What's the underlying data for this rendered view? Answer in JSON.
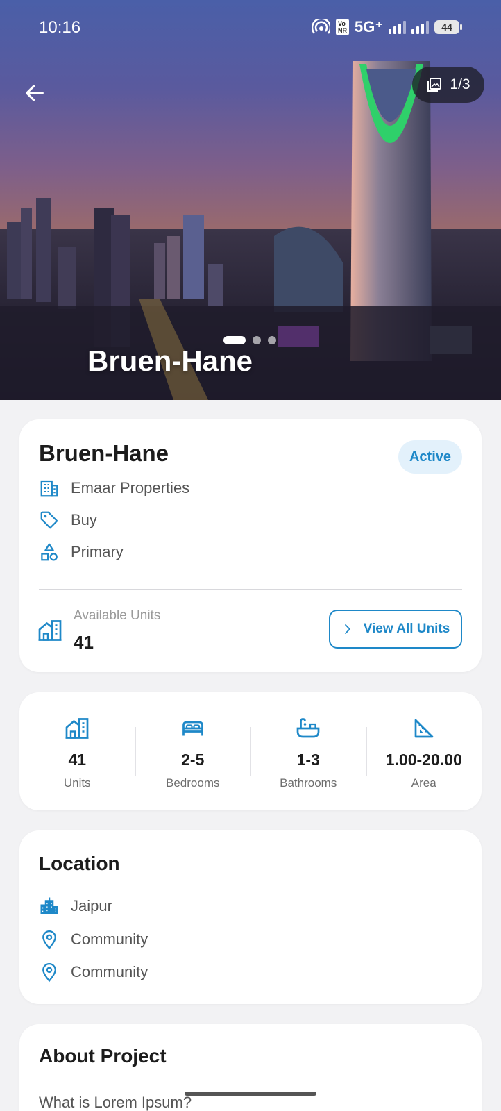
{
  "status_bar": {
    "time": "10:16",
    "network": "5G⁺",
    "vo_top": "Vo",
    "vo_bottom": "NR",
    "battery": "44"
  },
  "hero": {
    "image_counter": "1/3",
    "title": "Bruen-Hane",
    "slide_count": 3,
    "active_slide": 1
  },
  "project": {
    "name": "Bruen-Hane",
    "status": "Active",
    "developer": "Emaar Properties",
    "purpose": "Buy",
    "market": "Primary",
    "available_units_label": "Available Units",
    "available_units_value": "41",
    "view_all_label": "View All Units"
  },
  "stats": [
    {
      "icon": "building-icon",
      "value": "41",
      "label": "Units"
    },
    {
      "icon": "bed-icon",
      "value": "2-5",
      "label": "Bedrooms"
    },
    {
      "icon": "bathtub-icon",
      "value": "1-3",
      "label": "Bathrooms"
    },
    {
      "icon": "ruler-triangle-icon",
      "value": "1.00-20.00",
      "label": "Area"
    }
  ],
  "location": {
    "title": "Location",
    "city": "Jaipur",
    "area": "Community",
    "community": "Community"
  },
  "about": {
    "title": "About Project",
    "text": "What is Lorem Ipsum?"
  },
  "colors": {
    "accent": "#1e88c8",
    "badge_bg": "#e3f1fb",
    "page_bg": "#f2f2f4"
  }
}
